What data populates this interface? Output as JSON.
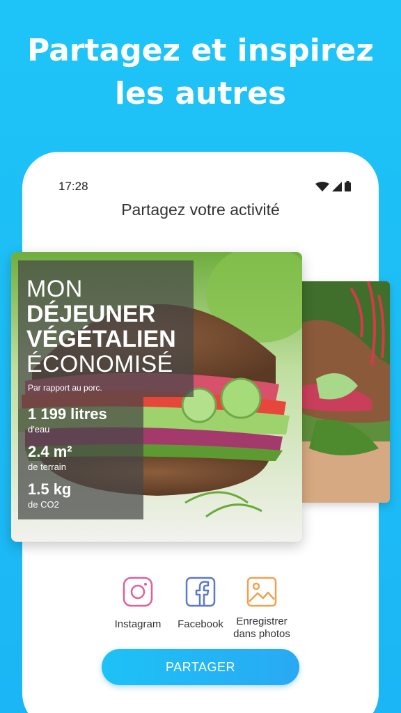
{
  "headline": {
    "line1": "Partagez et inspirez",
    "line2": "les autres"
  },
  "status_bar": {
    "time": "17:28",
    "icons": [
      "wifi-icon",
      "signal-icon",
      "battery-icon"
    ]
  },
  "screen": {
    "title": "Partagez votre activité"
  },
  "card": {
    "title_line1": "MON",
    "title_line2": "DÉJEUNER",
    "title_line3": "VÉGÉTALIEN",
    "title_line4": "ÉCONOMISÉ",
    "comparison": "Par rapport au porc.",
    "stats": [
      {
        "value": "1 199 litres",
        "unit": "d'eau"
      },
      {
        "value": "2.4 m²",
        "unit": "de terrain"
      },
      {
        "value": "1.5 kg",
        "unit": "de CO2"
      }
    ]
  },
  "share_options": [
    {
      "label": "Instagram",
      "icon": "instagram-icon",
      "color": "#E0609A"
    },
    {
      "label": "Facebook",
      "icon": "facebook-icon",
      "color": "#5C78C8"
    },
    {
      "label_line1": "Enregistrer",
      "label_line2": "dans photos",
      "icon": "save-photo-icon",
      "color": "#F0A24E"
    }
  ],
  "cta": {
    "label": "PARTAGER"
  },
  "colors": {
    "background": "#1EC4F7",
    "button": "#1DC2F6"
  }
}
